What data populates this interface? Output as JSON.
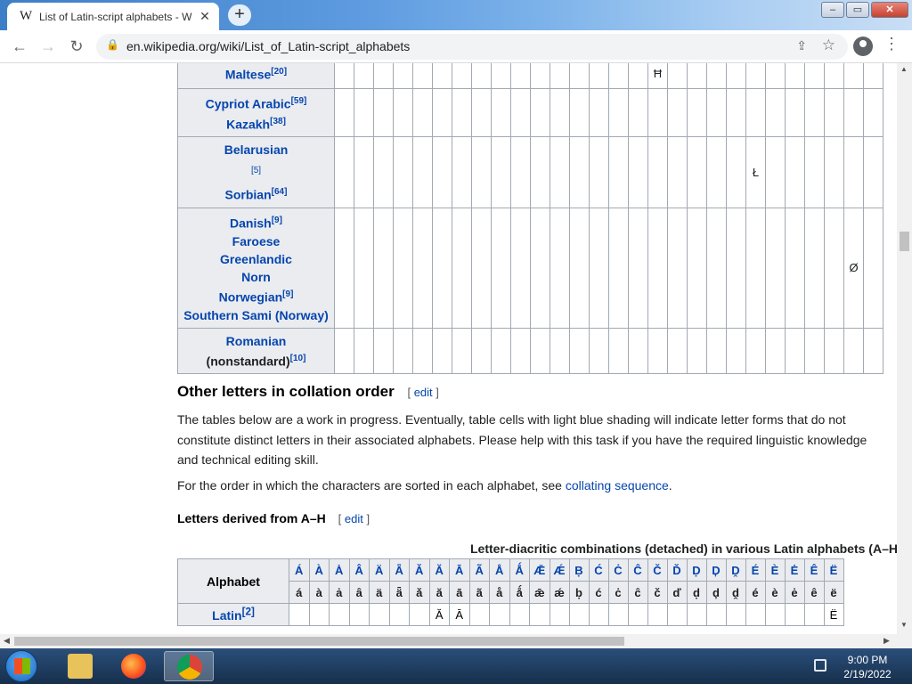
{
  "browser": {
    "tab_title": "List of Latin-script alphabets - W",
    "tab_favicon": "W",
    "url": "en.wikipedia.org/wiki/List_of_Latin-script_alphabets"
  },
  "top_table": {
    "rows": [
      {
        "langs": [
          {
            "name": "Maltese",
            "ref": "[20]"
          }
        ],
        "letter": "Ħ"
      },
      {
        "langs": [
          {
            "name": "Cypriot Arabic",
            "ref": "[59]"
          },
          {
            "name": "Kazakh",
            "ref": "[38]"
          }
        ],
        "letter": ""
      },
      {
        "langs": [
          {
            "name": "Belarusian",
            "ref": ""
          },
          {
            "name": "[5]",
            "ref": ""
          },
          {
            "name": "Sorbian",
            "ref": "[64]"
          }
        ],
        "letter": "Ł"
      },
      {
        "langs": [
          {
            "name": "Danish",
            "ref": "[9]"
          },
          {
            "name": "Faroese",
            "ref": ""
          },
          {
            "name": "Greenlandic",
            "ref": ""
          },
          {
            "name": "Norn",
            "ref": ""
          },
          {
            "name": "Norwegian",
            "ref": "[9]"
          },
          {
            "name": "Southern Sami (Norway)",
            "ref": ""
          }
        ],
        "letter": "Ø"
      },
      {
        "langs": [
          {
            "name": "Romanian",
            "ref": ""
          }
        ],
        "plain": "(nonstandard)",
        "plain_ref": "[10]",
        "letter": ""
      }
    ]
  },
  "section": {
    "title": "Other letters in collation order",
    "edit_label": "edit",
    "para1": "The tables below are a work in progress. Eventually, table cells with light blue shading will indicate letter forms that do not constitute distinct letters in their associated alphabets. Please help with this task if you have the required linguistic knowledge and technical editing skill.",
    "para2_prefix": "For the order in which the characters are sorted in each alphabet, see ",
    "para2_link": "collating sequence",
    "para2_suffix": "."
  },
  "subsection": {
    "title": "Letters derived from A–H",
    "edit_label": "edit"
  },
  "bottom_table": {
    "caption": "Letter-diacritic combinations (detached) in various Latin alphabets (A–H",
    "alphabet_header": "Alphabet",
    "upper": [
      "Á",
      "À",
      "Ȧ",
      "Â",
      "Ä",
      "Ǟ",
      "Ǎ",
      "Ă",
      "Ā",
      "Ã",
      "Å",
      "Ǻ",
      "Ǣ",
      "Ǽ",
      "Ḅ",
      "Ć",
      "Ċ",
      "Ĉ",
      "Č",
      "Ď",
      "Ḍ",
      "Ḑ",
      "Ḓ",
      "É",
      "È",
      "Ė",
      "Ê",
      "Ë"
    ],
    "lower": [
      "á",
      "à",
      "ȧ",
      "â",
      "ä",
      "ǟ",
      "ǎ",
      "ă",
      "ā",
      "ã",
      "å",
      "ǻ",
      "ǣ",
      "ǽ",
      "ḅ",
      "ć",
      "ċ",
      "ĉ",
      "č",
      "ď",
      "ḍ",
      "ḑ",
      "ḓ",
      "é",
      "è",
      "ė",
      "ê",
      "ë"
    ],
    "latin_row": {
      "name": "Latin",
      "ref": "[2]",
      "cells": {
        "7": "Ă",
        "8": "Ā",
        "27": "Ë"
      }
    }
  },
  "taskbar": {
    "time": "9:00 PM",
    "date": "2/19/2022"
  }
}
